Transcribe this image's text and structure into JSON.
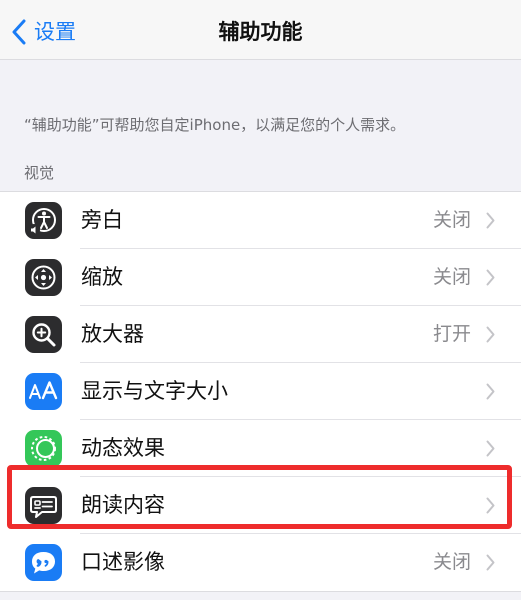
{
  "nav": {
    "back_label": "设置",
    "title": "辅助功能"
  },
  "description": "“辅助功能”可帮助您自定iPhone，以满足您的个人需求。",
  "section": {
    "header": "视觉",
    "items": [
      {
        "label": "旁白",
        "value": "关闭",
        "icon": "voiceover-icon",
        "icon_color": "#2c2c2e"
      },
      {
        "label": "缩放",
        "value": "关闭",
        "icon": "zoom-icon",
        "icon_color": "#2c2c2e"
      },
      {
        "label": "放大器",
        "value": "打开",
        "icon": "magnifier-icon",
        "icon_color": "#2c2c2e"
      },
      {
        "label": "显示与文字大小",
        "value": "",
        "icon": "text-size-icon",
        "icon_color": "#1a7cf5"
      },
      {
        "label": "动态效果",
        "value": "",
        "icon": "motion-icon",
        "icon_color": "#34c759"
      },
      {
        "label": "朗读内容",
        "value": "",
        "icon": "spoken-content-icon",
        "icon_color": "#2c2c2e"
      },
      {
        "label": "口述影像",
        "value": "关闭",
        "icon": "audio-descriptions-icon",
        "icon_color": "#1a7cf5"
      }
    ]
  },
  "colors": {
    "accent": "#1a7cf5",
    "highlight": "#ee2c2c",
    "background": "#f2f2f7"
  }
}
